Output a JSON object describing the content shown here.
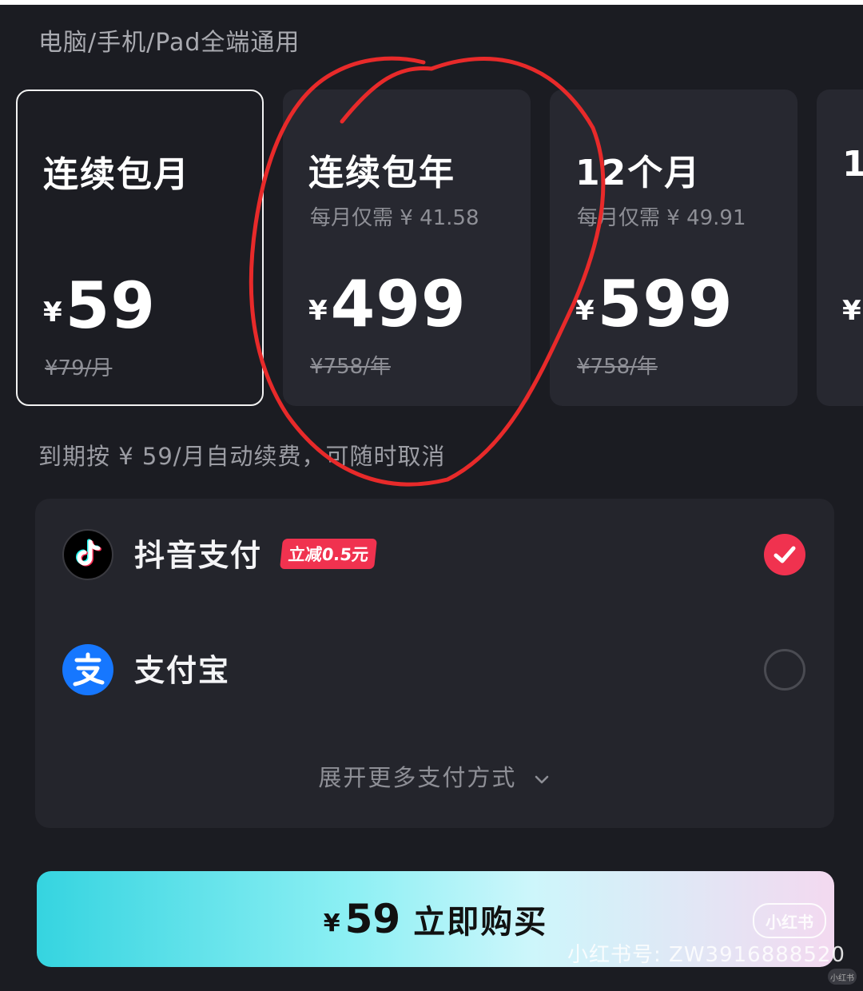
{
  "header": {
    "subtitle": "电脑/手机/Pad全端通用"
  },
  "plans": [
    {
      "name": "连续包月",
      "per_month": "",
      "currency": "¥",
      "price": "59",
      "original": "¥79/月",
      "selected": true
    },
    {
      "name": "连续包年",
      "per_month": "每月仅需 ¥ 41.58",
      "currency": "¥",
      "price": "499",
      "original": "¥758/年",
      "selected": false
    },
    {
      "name": "12个月",
      "per_month": "每月仅需 ¥ 49.91",
      "currency": "¥",
      "price": "599",
      "original": "¥758/年",
      "selected": false
    },
    {
      "name": "1",
      "per_month": "",
      "currency": "¥",
      "price": "",
      "original": "",
      "selected": false
    }
  ],
  "renew_note": "到期按 ¥ 59/月自动续费，可随时取消",
  "payment": {
    "methods": [
      {
        "label": "抖音支付",
        "badge": "立减0.5元",
        "icon": "douyin-icon",
        "selected": true
      },
      {
        "label": "支付宝",
        "badge": "",
        "icon": "alipay-icon",
        "selected": false
      }
    ],
    "expand_label": "展开更多支付方式",
    "expand_icon": "chevron-down-icon"
  },
  "buy_button": {
    "currency": "¥",
    "amount": "59",
    "action": "立即购买"
  },
  "watermark": {
    "logo_text": "小红书",
    "id_text": "小红书号: ZW3916888520",
    "corner_text": "小红书"
  },
  "colors": {
    "background": "#1b1c22",
    "card": "#272830",
    "accent_red": "#f0324f",
    "alipay_blue": "#1677ff",
    "annotation_red": "#e82a2a"
  }
}
